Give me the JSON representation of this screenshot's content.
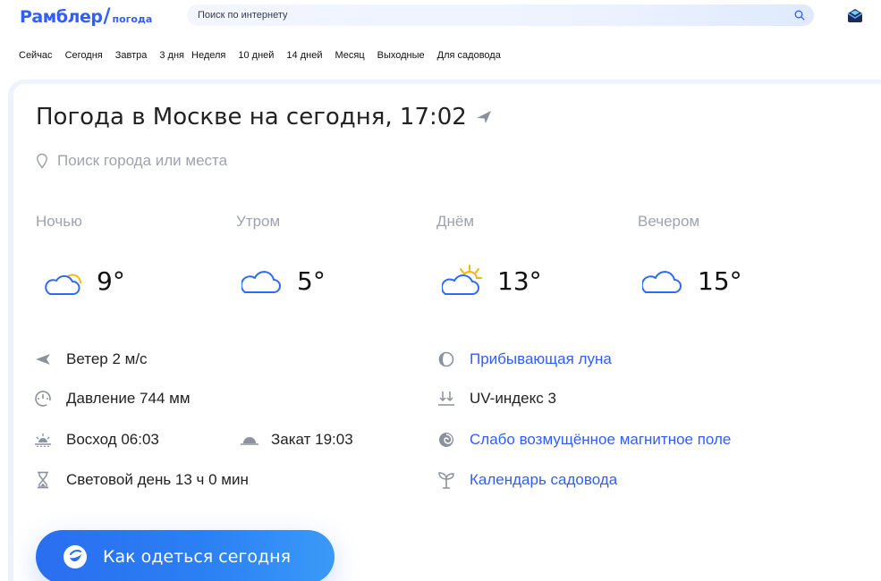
{
  "header": {
    "logo_main": "Рамблер",
    "logo_slash": "/",
    "logo_sub": "погода",
    "search_placeholder": "Поиск по интернету",
    "search_icon": "search-icon",
    "mail_icon": "mail-icon"
  },
  "nav": {
    "items": [
      "Сейчас",
      "Сегодня",
      "Завтра",
      "3 дня",
      "Неделя",
      "10 дней",
      "14 дней",
      "Месяц",
      "Выходные",
      "Для садовода"
    ]
  },
  "main": {
    "title": "Погода в Москве на сегодня, 17:02",
    "title_icon": "location-arrow-icon",
    "city_search_placeholder": "Поиск города или места",
    "periods": [
      {
        "label": "Ночью",
        "temp": "9°",
        "icon": "partly-cloudy-night-icon"
      },
      {
        "label": "Утром",
        "temp": "5°",
        "icon": "cloud-icon"
      },
      {
        "label": "Днём",
        "temp": "13°",
        "icon": "partly-sunny-icon"
      },
      {
        "label": "Вечером",
        "temp": "15°",
        "icon": "cloud-icon"
      }
    ],
    "details_left": {
      "wind": "Ветер 2 м/с",
      "pressure": "Давление 744 мм",
      "sunrise": "Восход 06:03",
      "sunset": "Закат 19:03",
      "daylight": "Световой день 13 ч 0 мин"
    },
    "details_right": {
      "moon": "Прибывающая луна",
      "uv": "UV-индекс 3",
      "magnetic": "Слабо возмущённое магнитное поле",
      "garden": "Календарь садовода"
    },
    "cta_label": "Как одеться сегодня"
  },
  "colors": {
    "accent": "#315efb",
    "muted": "#9ea3ad",
    "cta_start": "#2a6ef0",
    "cta_end": "#3a9af7",
    "sun": "#f5b800"
  }
}
